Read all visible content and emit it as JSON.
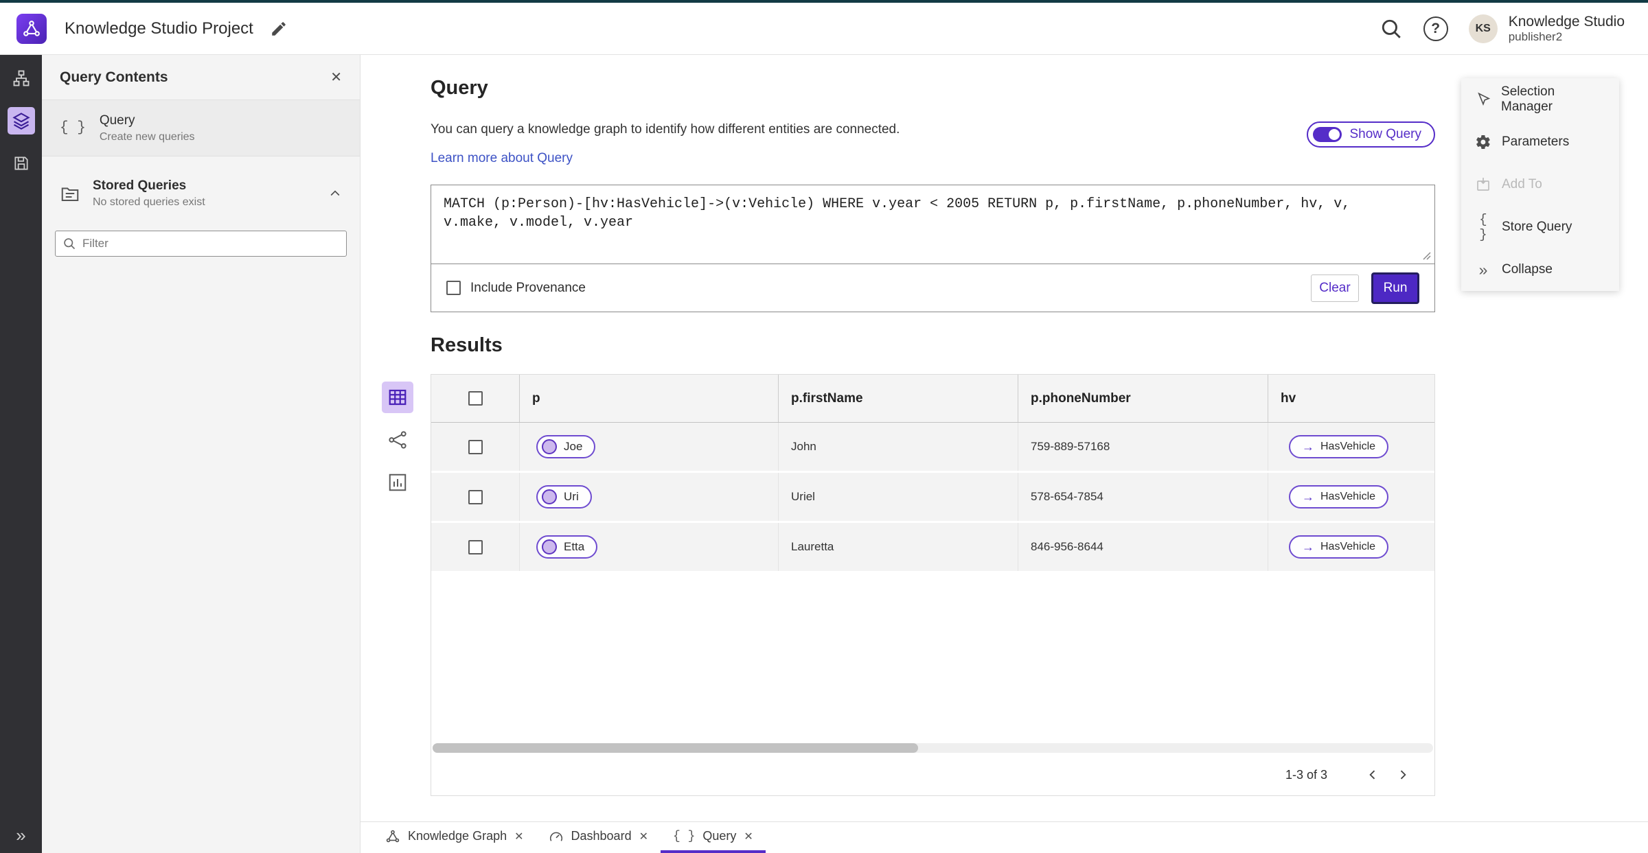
{
  "header": {
    "title": "Knowledge Studio Project",
    "user": {
      "initials": "KS",
      "app_name": "Knowledge Studio",
      "username": "publisher2"
    }
  },
  "sidebar": {
    "title": "Query Contents",
    "query_item": {
      "label": "Query",
      "sublabel": "Create new queries"
    },
    "stored": {
      "label": "Stored Queries",
      "sublabel": "No stored queries exist"
    },
    "filter_placeholder": "Filter"
  },
  "query_panel": {
    "title": "Query",
    "description": "You can query a knowledge graph to identify how different entities are connected.",
    "learn_more": "Learn more about Query",
    "show_query_label": "Show Query",
    "query_text": "MATCH (p:Person)-[hv:HasVehicle]->(v:Vehicle) WHERE v.year < 2005 RETURN p, p.firstName, p.phoneNumber, hv, v, v.make, v.model, v.year",
    "include_provenance_label": "Include Provenance",
    "clear_label": "Clear",
    "run_label": "Run"
  },
  "results": {
    "title": "Results",
    "columns": [
      "p",
      "p.firstName",
      "p.phoneNumber",
      "hv"
    ],
    "rows": [
      {
        "p": "Joe",
        "firstName": "John",
        "phoneNumber": "759-889-57168",
        "hv": "HasVehicle"
      },
      {
        "p": "Uri",
        "firstName": "Uriel",
        "phoneNumber": "578-654-7854",
        "hv": "HasVehicle"
      },
      {
        "p": "Etta",
        "firstName": "Lauretta",
        "phoneNumber": "846-956-8644",
        "hv": "HasVehicle"
      }
    ],
    "pagination": "1-3 of 3"
  },
  "context_menu": {
    "items": [
      {
        "label": "Selection Manager",
        "disabled": false
      },
      {
        "label": "Parameters",
        "disabled": false
      },
      {
        "label": "Add To",
        "disabled": true
      },
      {
        "label": "Store Query",
        "disabled": false
      },
      {
        "label": "Collapse",
        "disabled": false
      }
    ]
  },
  "tabs": [
    {
      "label": "Knowledge Graph",
      "active": false
    },
    {
      "label": "Dashboard",
      "active": false
    },
    {
      "label": "Query",
      "active": true
    }
  ],
  "icons": {
    "help": "?",
    "close": "✕",
    "braces": "{ }",
    "collapse": "»",
    "arrow_right": "→"
  },
  "colors": {
    "accent": "#552dc8",
    "accent_dark": "#241e5e",
    "selected_icon_bg": "#d8c6f6",
    "link": "#3d52c5",
    "rail_bg": "#303034",
    "sidebar_bg": "#f4f4f4"
  }
}
